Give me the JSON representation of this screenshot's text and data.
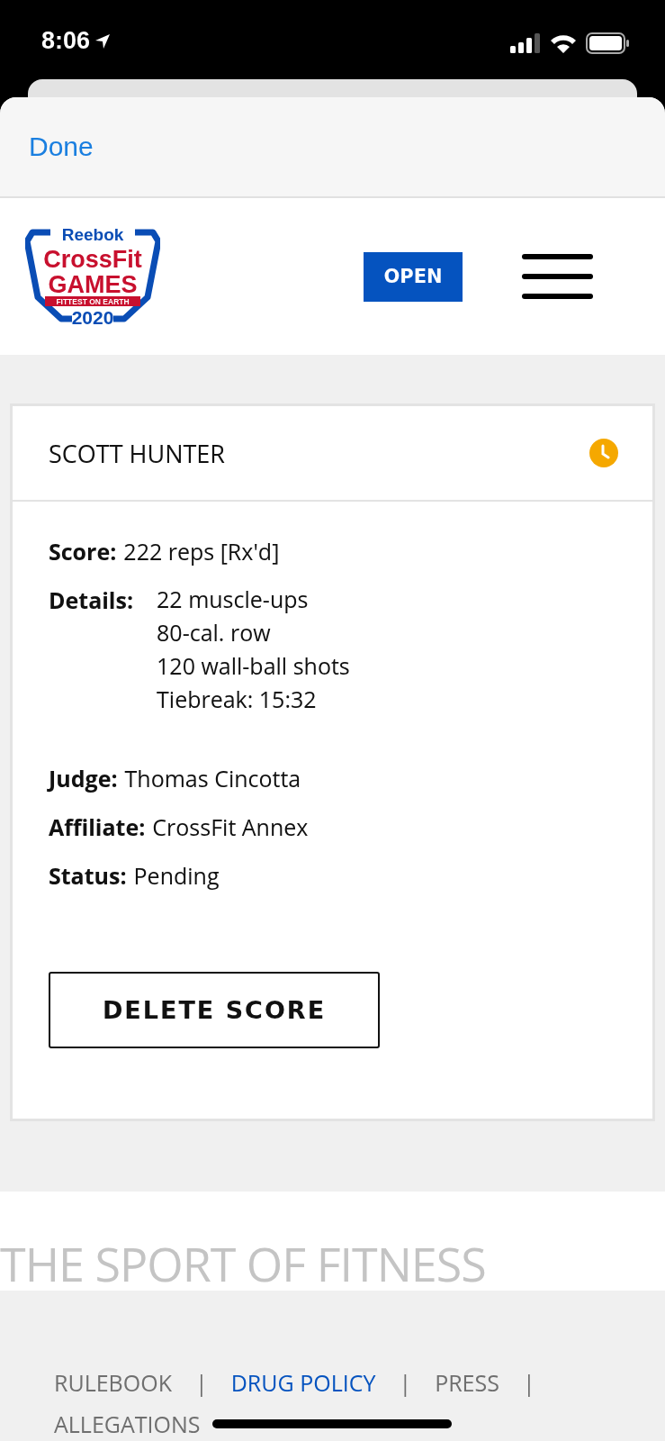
{
  "status_bar": {
    "time": "8:06"
  },
  "sheet": {
    "done_label": "Done"
  },
  "header": {
    "logo": {
      "brand": "Reebok",
      "line1": "CrossFit",
      "line2": "GAMES",
      "tagline": "FITTEST ON EARTH",
      "year": "2020"
    },
    "open_button": "OPEN"
  },
  "card": {
    "athlete": "SCOTT HUNTER",
    "fields": [
      {
        "label": "Score:",
        "kind": "inline",
        "value": "222 reps [Rx'd]"
      },
      {
        "label": "Details:",
        "kind": "lines",
        "lines": [
          "22 muscle-ups",
          "80-cal. row",
          "120 wall-ball shots",
          "Tiebreak: 15:32"
        ]
      },
      {
        "label": "Judge:",
        "kind": "inline",
        "value": "Thomas Cincotta"
      },
      {
        "label": "Affiliate:",
        "kind": "inline",
        "value": "CrossFit Annex"
      },
      {
        "label": "Status:",
        "kind": "inline",
        "value": "Pending"
      }
    ],
    "delete_button": "DELETE SCORE"
  },
  "banner": {
    "text": "THE SPORT OF FITNESS"
  },
  "footer": {
    "links": [
      {
        "kind": "link",
        "label": "RULEBOOK",
        "selected": false
      },
      {
        "kind": "separator",
        "label": "|"
      },
      {
        "kind": "link",
        "label": "DRUG POLICY",
        "selected": true
      },
      {
        "kind": "separator",
        "label": "|"
      },
      {
        "kind": "link",
        "label": "PRESS",
        "selected": false
      },
      {
        "kind": "separator",
        "label": "|"
      },
      {
        "kind": "link",
        "label": "ALLEGATIONS",
        "selected": false
      }
    ]
  }
}
